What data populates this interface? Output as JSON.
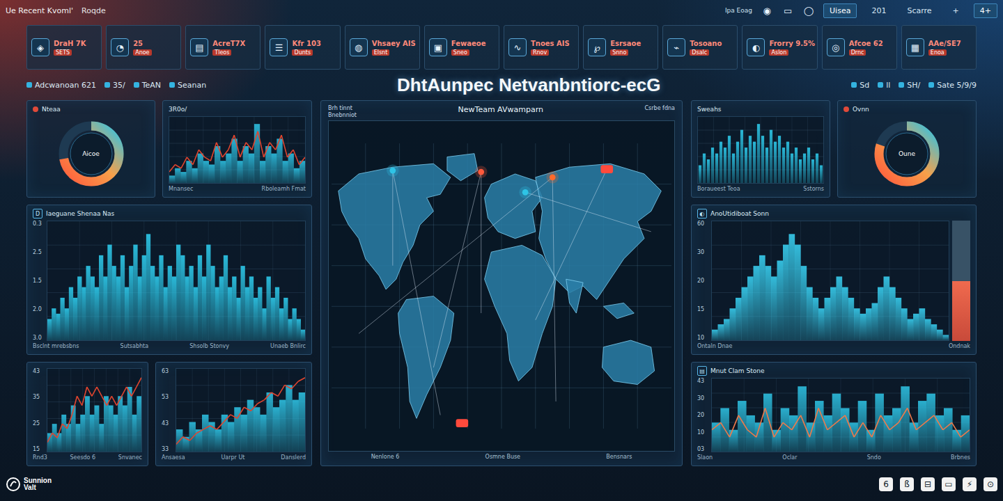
{
  "topbar": {
    "title": "Ue Recent Kvoml'",
    "subtitle": "Roqde",
    "label": "Ipa Eoag",
    "icons": [
      "◉",
      "▭",
      "◯"
    ],
    "tabs": [
      {
        "label": "Uisea",
        "selected": true
      },
      {
        "label": "201",
        "selected": false
      },
      {
        "label": "Scarre",
        "selected": false
      },
      {
        "label": "+",
        "selected": false
      },
      {
        "label": "4+",
        "selected": true
      }
    ]
  },
  "kpis": [
    {
      "icon": "◈",
      "value": "DraH 7K",
      "sub": "SETS"
    },
    {
      "icon": "◔",
      "value": "25",
      "sub": "Anoe"
    },
    {
      "icon": "▤",
      "value": "AcreT7X",
      "sub": "Tleos"
    },
    {
      "icon": "☰",
      "value": "Kfr 103",
      "sub": "Dunts"
    },
    {
      "icon": "◍",
      "value": "Vhsaey AIS",
      "sub": "Elsnt"
    },
    {
      "icon": "▣",
      "value": "Fewaeoe",
      "sub": "Sneo"
    },
    {
      "icon": "∿",
      "value": "Tnoes AIS",
      "sub": "Rnov"
    },
    {
      "icon": "℘",
      "value": "Esrsaoe",
      "sub": "Snno"
    },
    {
      "icon": "⌁",
      "value": "Tosoano",
      "sub": "Dsalc"
    },
    {
      "icon": "◐",
      "value": "Frorry 9.5%",
      "sub": "Aslon"
    },
    {
      "icon": "◎",
      "value": "Afcoe 62",
      "sub": "Drnc"
    },
    {
      "icon": "▦",
      "value": "AAe/SE7",
      "sub": "Enoa"
    }
  ],
  "strip": {
    "left": [
      "Adcwanoan 621",
      "35/",
      "TeAN",
      "Seanan"
    ],
    "title": "DhtAunpec Netvanbntiorc-ecG",
    "right": [
      "Sd",
      "ll",
      "SH/",
      "Sate 5/9/9"
    ]
  },
  "gauges": {
    "left": {
      "title": "Nteaa",
      "label": "Aicoe",
      "level": 0.72
    },
    "right": {
      "title": "Ovnn",
      "label": "Oune",
      "level": 0.8
    }
  },
  "charts": {
    "left_top": {
      "title": "3R0o/",
      "ticks": [],
      "footer": [
        "Mnansec",
        "Rboleamh Fmat"
      ],
      "series": [
        {
          "kind": "area",
          "color": "#2bb6d6",
          "values": [
            1,
            2,
            1.5,
            3,
            2,
            4,
            3,
            2.5,
            5,
            3,
            4,
            6,
            3,
            5,
            4,
            8,
            3,
            5,
            4,
            6,
            3,
            4,
            2,
            3
          ]
        },
        {
          "kind": "line",
          "color": "#e0452f",
          "values": [
            1.5,
            2.5,
            2,
            3.5,
            2.5,
            4.5,
            3.5,
            3,
            5.5,
            3.5,
            4.5,
            6.5,
            3.5,
            5.5,
            4.5,
            7,
            3.5,
            5.5,
            4.5,
            6.5,
            3.5,
            4.5,
            2.5,
            3.5
          ]
        }
      ]
    },
    "left_main": {
      "icon": "D",
      "title": "Iaeguane Shenaa Nas",
      "ticks": [
        "0.3",
        "2.5",
        "1.5",
        "2.0",
        "3.0"
      ],
      "footer": [
        "Bsclnt mrebsbns",
        "Sutsabhta",
        "Shsolb Stonvy",
        "Unaeb Bnlirc"
      ],
      "series": [
        {
          "kind": "area",
          "color": "#2bc0e0",
          "values": [
            2,
            3,
            2.5,
            4,
            3,
            5,
            4,
            6,
            5,
            7,
            6,
            5,
            8,
            6,
            9,
            7,
            6,
            8,
            5,
            7,
            9,
            6,
            8,
            10,
            7,
            6,
            8,
            5,
            7,
            6,
            9,
            8,
            6,
            7,
            5,
            8,
            6,
            9,
            7,
            5,
            6,
            8,
            5,
            6,
            4,
            7,
            5,
            6,
            4,
            5,
            3,
            6,
            4,
            5,
            3,
            4,
            2,
            3,
            2,
            1
          ]
        }
      ]
    },
    "left_bottom_a": {
      "ticks": [
        "43",
        "35",
        "25",
        "15"
      ],
      "footer": [
        "Rnd3",
        "Seesdo 6",
        "Snvanec"
      ],
      "series": [
        {
          "kind": "area",
          "color": "#2bb6d6",
          "values": [
            2,
            3,
            2,
            4,
            3,
            5,
            3,
            4,
            6,
            4,
            5,
            3,
            6,
            5,
            4,
            6,
            5,
            7,
            4,
            6
          ]
        },
        {
          "kind": "line",
          "color": "#e0452f",
          "values": [
            1,
            2,
            1.5,
            3,
            2.5,
            4,
            6,
            5,
            7,
            6,
            7,
            6,
            5,
            6,
            5,
            6,
            7,
            6,
            7,
            8
          ]
        }
      ]
    },
    "left_bottom_b": {
      "ticks": [
        "63",
        "53",
        "43",
        "33"
      ],
      "footer": [
        "Ansaesa",
        "Uarpr Ut",
        "Danslerd"
      ],
      "series": [
        {
          "kind": "area",
          "color": "#2bb6d6",
          "values": [
            3,
            2,
            4,
            3,
            5,
            4,
            3,
            5,
            4,
            6,
            5,
            7,
            6,
            5,
            8,
            6,
            7,
            9,
            7,
            8
          ]
        },
        {
          "kind": "line",
          "color": "#e0452f",
          "values": [
            1,
            2,
            1.5,
            2.5,
            3,
            3.5,
            3,
            4,
            5,
            4.5,
            6,
            5.5,
            6.5,
            7,
            8,
            7.5,
            9,
            8.5,
            9.5,
            10
          ]
        }
      ]
    },
    "right_top": {
      "title": "Sweahs",
      "ticks": [],
      "footer": [
        "Boraueest Teoa",
        "Sstorns"
      ],
      "series": [
        {
          "kind": "bars",
          "color": "#2bc0e0",
          "values": [
            3,
            5,
            4,
            6,
            5,
            7,
            6,
            8,
            5,
            7,
            9,
            6,
            8,
            7,
            10,
            8,
            6,
            9,
            7,
            8,
            6,
            7,
            5,
            6,
            4,
            5,
            6,
            4,
            5,
            3
          ]
        }
      ]
    },
    "right_main": {
      "icon": "◐",
      "title": "AnoUtidiboat Sonn",
      "ticks": [
        "60",
        "30",
        "20",
        "15",
        "10"
      ],
      "footer": [
        "Ontaln Dnae",
        "Ondnak"
      ],
      "meter": {
        "level": 0.5
      },
      "series": [
        {
          "kind": "area",
          "color": "#35c3e3",
          "values": [
            1,
            1.5,
            2,
            3,
            4,
            5,
            6,
            7,
            8,
            7,
            6,
            7.5,
            9,
            10,
            9,
            7,
            5,
            4,
            3,
            4,
            5,
            6,
            5,
            4,
            3,
            2.5,
            3,
            3.5,
            5,
            6,
            5,
            4,
            3,
            2,
            2.5,
            3,
            2,
            1.5,
            1,
            0.5
          ]
        }
      ]
    },
    "right_bottom": {
      "icon": "▤",
      "title": "Mnut Clam Stone",
      "ticks": [
        "43",
        "30",
        "20",
        "10",
        "03"
      ],
      "footer": [
        "Slaon",
        "Oclar",
        "Sndo",
        "Brbnes"
      ],
      "series": [
        {
          "kind": "area",
          "color": "#2bb6d6",
          "values": [
            4,
            6,
            3,
            7,
            5,
            4,
            8,
            3,
            6,
            5,
            9,
            4,
            7,
            5,
            8,
            6,
            4,
            7,
            3,
            8,
            5,
            6,
            9,
            4,
            7,
            8,
            5,
            6,
            3,
            5
          ]
        },
        {
          "kind": "line",
          "color": "#f07a4a",
          "values": [
            3,
            4,
            2,
            5,
            3,
            2,
            6,
            2,
            4,
            3,
            5,
            2,
            6,
            3,
            4,
            5,
            2,
            4,
            2,
            5,
            3,
            4,
            6,
            3,
            4,
            5,
            3,
            4,
            2,
            3
          ]
        }
      ]
    }
  },
  "map": {
    "title": "NewTeam AVwamparn",
    "left": [
      "Brh tinnt",
      "Bnebnniot"
    ],
    "right": [
      "Csrbe fdna"
    ],
    "footer": [
      "Nenlone 6",
      "Osmne Buse",
      "Bensnars"
    ],
    "pins": [
      {
        "kind": "dot",
        "color": "#2ec4e6"
      },
      {
        "kind": "dot",
        "color": "#ff5a3c"
      },
      {
        "kind": "dot",
        "color": "#ff6a2c"
      },
      {
        "kind": "flag",
        "color": "#ff4a3c"
      },
      {
        "kind": "dot",
        "color": "#2ec4e6"
      },
      {
        "kind": "flag",
        "color": "#ff4a3c"
      }
    ]
  },
  "bottom": {
    "logo": [
      "Sunnion",
      "Valt"
    ],
    "icons": [
      "6",
      "ß",
      "⊟",
      "▭",
      "⚡",
      "⊙"
    ]
  }
}
